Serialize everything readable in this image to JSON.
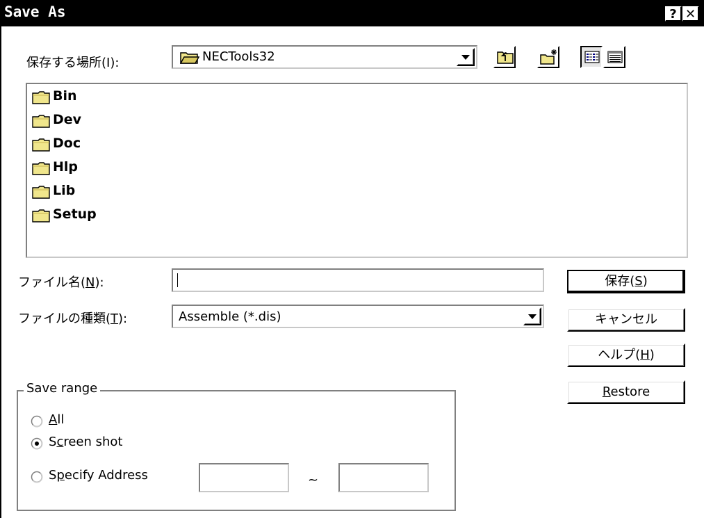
{
  "window": {
    "title": "Save As",
    "help_button": "?",
    "close_button": "✕"
  },
  "location": {
    "label": "保存する場所(I):",
    "label_mnemonic": "I",
    "value": "NECTools32",
    "icon": "folder-open-icon"
  },
  "toolbar": {
    "up_folder_icon": "up-folder-icon",
    "new_folder_icon": "new-folder-icon",
    "list_view_icon": "list-view-icon",
    "details_view_icon": "details-view-icon"
  },
  "files": [
    {
      "name": "Bin",
      "icon": "folder-icon"
    },
    {
      "name": "Dev",
      "icon": "folder-icon"
    },
    {
      "name": "Doc",
      "icon": "folder-icon"
    },
    {
      "name": "Hlp",
      "icon": "folder-icon"
    },
    {
      "name": "Lib",
      "icon": "folder-icon"
    },
    {
      "name": "Setup",
      "icon": "folder-icon"
    }
  ],
  "filename": {
    "label_text": "ファイル名(",
    "label_key": "N",
    "label_end": "):",
    "value": ""
  },
  "filetype": {
    "label_text": "ファイルの種類(",
    "label_key": "T",
    "label_end": "):",
    "value": "Assemble (*.dis)"
  },
  "buttons": {
    "save_text": "保存(",
    "save_key": "S",
    "save_end": ")",
    "cancel": "キャンセル",
    "help_text": "ヘルプ(",
    "help_key": "H",
    "help_end": ")",
    "restore_key": "R",
    "restore_rest": "estore"
  },
  "save_range": {
    "legend": "Save range",
    "options": [
      {
        "pre": "",
        "key": "A",
        "post": "ll",
        "selected": false
      },
      {
        "pre": "S",
        "key": "c",
        "post": "reen shot",
        "selected": true
      },
      {
        "pre": "S",
        "key": "p",
        "post": "ecify Address",
        "selected": false
      }
    ],
    "address_from": "",
    "address_separator": "~",
    "address_to": ""
  },
  "colors": {
    "titlebar": "#000000",
    "folder_fill": "#f0e68c",
    "folder_outline": "#000000"
  }
}
